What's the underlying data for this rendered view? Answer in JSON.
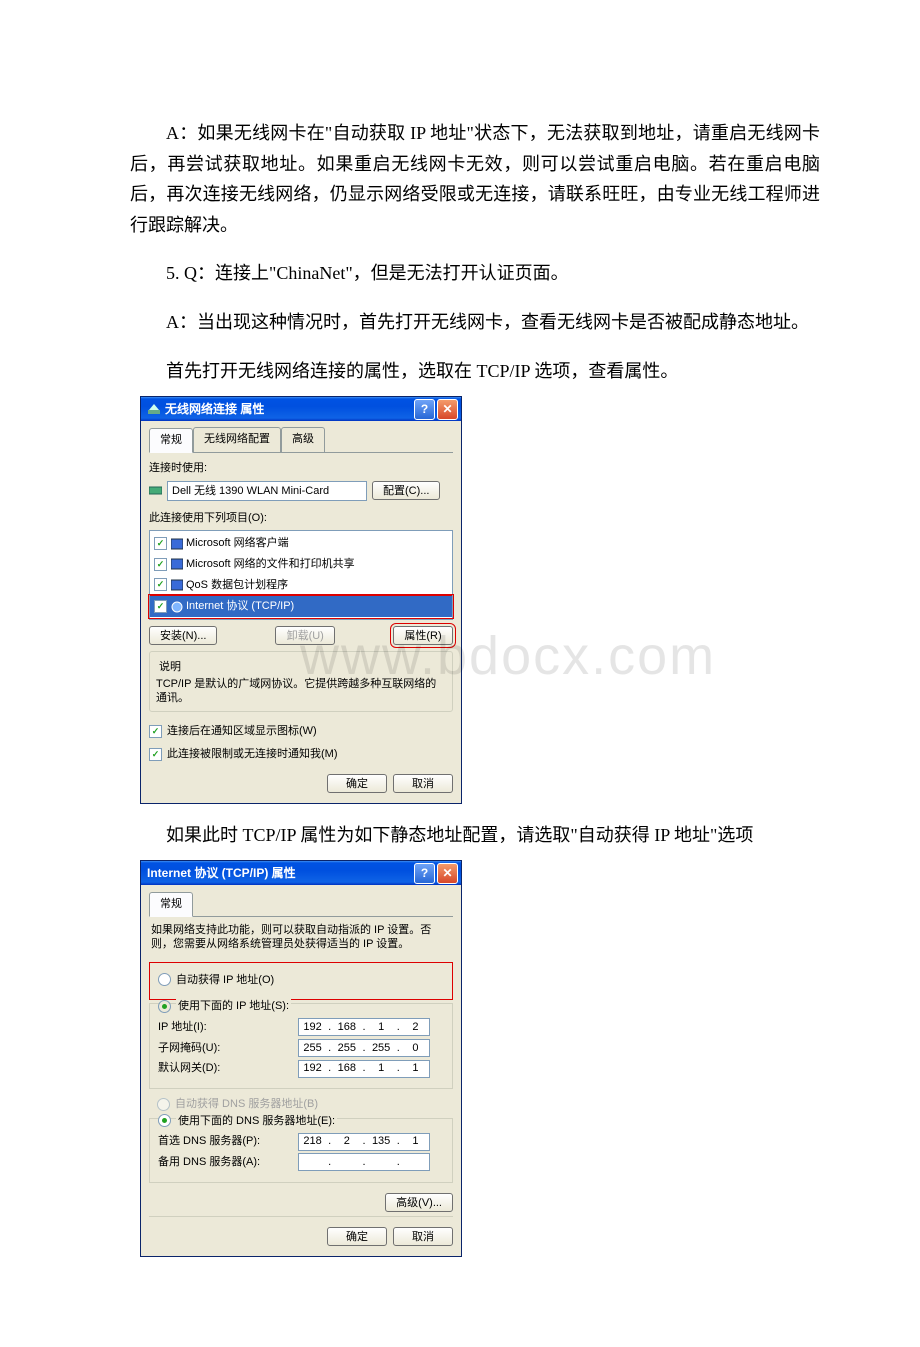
{
  "doc": {
    "para_a1": "A：如果无线网卡在\"自动获取 IP 地址\"状态下，无法获取到地址，请重启无线网卡后，再尝试获取地址。如果重启无线网卡无效，则可以尝试重启电脑。若在重启电脑后，再次连接无线网络，仍显示网络受限或无连接，请联系旺旺，由专业无线工程师进行跟踪解决。",
    "para_q5": "5. Q：连接上\"ChinaNet\"，但是无法打开认证页面。",
    "para_a5a": "A：当出现这种情况时，首先打开无线网卡，查看无线网卡是否被配成静态地址。",
    "para_a5b": "首先打开无线网络连接的属性，选取在 TCP/IP 选项，查看属性。",
    "para_mid": "如果此时 TCP/IP 属性为如下静态地址配置，请选取\"自动获得 IP 地址\"选项"
  },
  "watermark": "www.bdocx.com",
  "dlg1": {
    "title": "无线网络连接 属性",
    "tabs": {
      "general": "常规",
      "wireless": "无线网络配置",
      "advanced": "高级"
    },
    "connect_using": "连接时使用:",
    "adapter": "Dell 无线 1390 WLAN Mini-Card",
    "configure_btn": "配置(C)...",
    "items_label": "此连接使用下列项目(O):",
    "items": {
      "client": "Microsoft 网络客户端",
      "fps": "Microsoft 网络的文件和打印机共享",
      "qos": "QoS 数据包计划程序",
      "tcpip": "Internet 协议 (TCP/IP)"
    },
    "install_btn": "安装(N)...",
    "uninstall_btn": "卸载(U)",
    "properties_btn": "属性(R)",
    "desc_title": "说明",
    "desc_text": "TCP/IP 是默认的广域网协议。它提供跨越多种互联网络的通讯。",
    "notify_icon": "连接后在通知区域显示图标(W)",
    "notify_limited": "此连接被限制或无连接时通知我(M)",
    "ok": "确定",
    "cancel": "取消"
  },
  "dlg2": {
    "title": "Internet 协议 (TCP/IP) 属性",
    "tab_general": "常规",
    "desc": "如果网络支持此功能，则可以获取自动指派的 IP 设置。否则，您需要从网络系统管理员处获得适当的 IP 设置。",
    "auto_ip": "自动获得 IP 地址(O)",
    "use_ip": "使用下面的 IP 地址(S):",
    "ip_label": "IP 地址(I):",
    "ip_value": [
      "192",
      "168",
      "1",
      "2"
    ],
    "mask_label": "子网掩码(U):",
    "mask_value": [
      "255",
      "255",
      "255",
      "0"
    ],
    "gw_label": "默认网关(D):",
    "gw_value": [
      "192",
      "168",
      "1",
      "1"
    ],
    "auto_dns": "自动获得 DNS 服务器地址(B)",
    "use_dns": "使用下面的 DNS 服务器地址(E):",
    "dns1_label": "首选 DNS 服务器(P):",
    "dns1_value": [
      "218",
      "2",
      "135",
      "1"
    ],
    "dns2_label": "备用 DNS 服务器(A):",
    "dns2_value": [
      "",
      "",
      "",
      ""
    ],
    "advanced_btn": "高级(V)...",
    "ok": "确定",
    "cancel": "取消"
  }
}
